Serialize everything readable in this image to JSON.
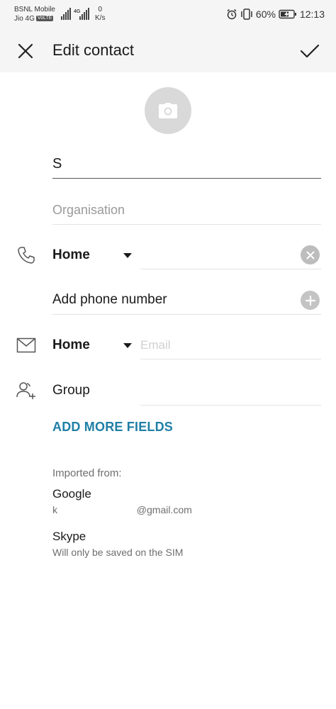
{
  "status_bar": {
    "carrier_1": "BSNL Mobile",
    "carrier_2": "Jio 4G",
    "volte_badge": "VoLTE",
    "net_speed_value": "0",
    "net_speed_unit": "K/s",
    "network_badge": "4G",
    "battery_percent": "60%",
    "time": "12:13",
    "icons": [
      "signal-icon",
      "alarm-icon",
      "vibrate-icon",
      "battery-charging-icon"
    ]
  },
  "app_bar": {
    "title": "Edit contact",
    "close_icon": "close-icon",
    "save_icon": "check-icon"
  },
  "avatar": {
    "icon": "camera-icon"
  },
  "name_field": {
    "value": "S"
  },
  "organisation_field": {
    "placeholder": "Organisation",
    "value": ""
  },
  "phone": {
    "icon": "phone-icon",
    "type": "Home",
    "value": "",
    "clear_icon": "clear-icon",
    "add_label": "Add phone number",
    "add_icon": "plus-icon"
  },
  "email": {
    "icon": "mail-icon",
    "type": "Home",
    "placeholder": "Email",
    "value": ""
  },
  "group": {
    "icon": "group-add-icon",
    "label": "Group"
  },
  "add_more_fields": "ADD MORE FIELDS",
  "imported": {
    "label": "Imported from:",
    "accounts": [
      {
        "name": "Google",
        "detail_prefix": "k",
        "detail_suffix": "@gmail.com"
      },
      {
        "name": "Skype",
        "detail": "Will only be saved on the SIM"
      }
    ]
  },
  "colors": {
    "accent": "#1f7fa6",
    "bar_background": "#f5f5f5",
    "avatar_background": "#d9d9d9"
  }
}
